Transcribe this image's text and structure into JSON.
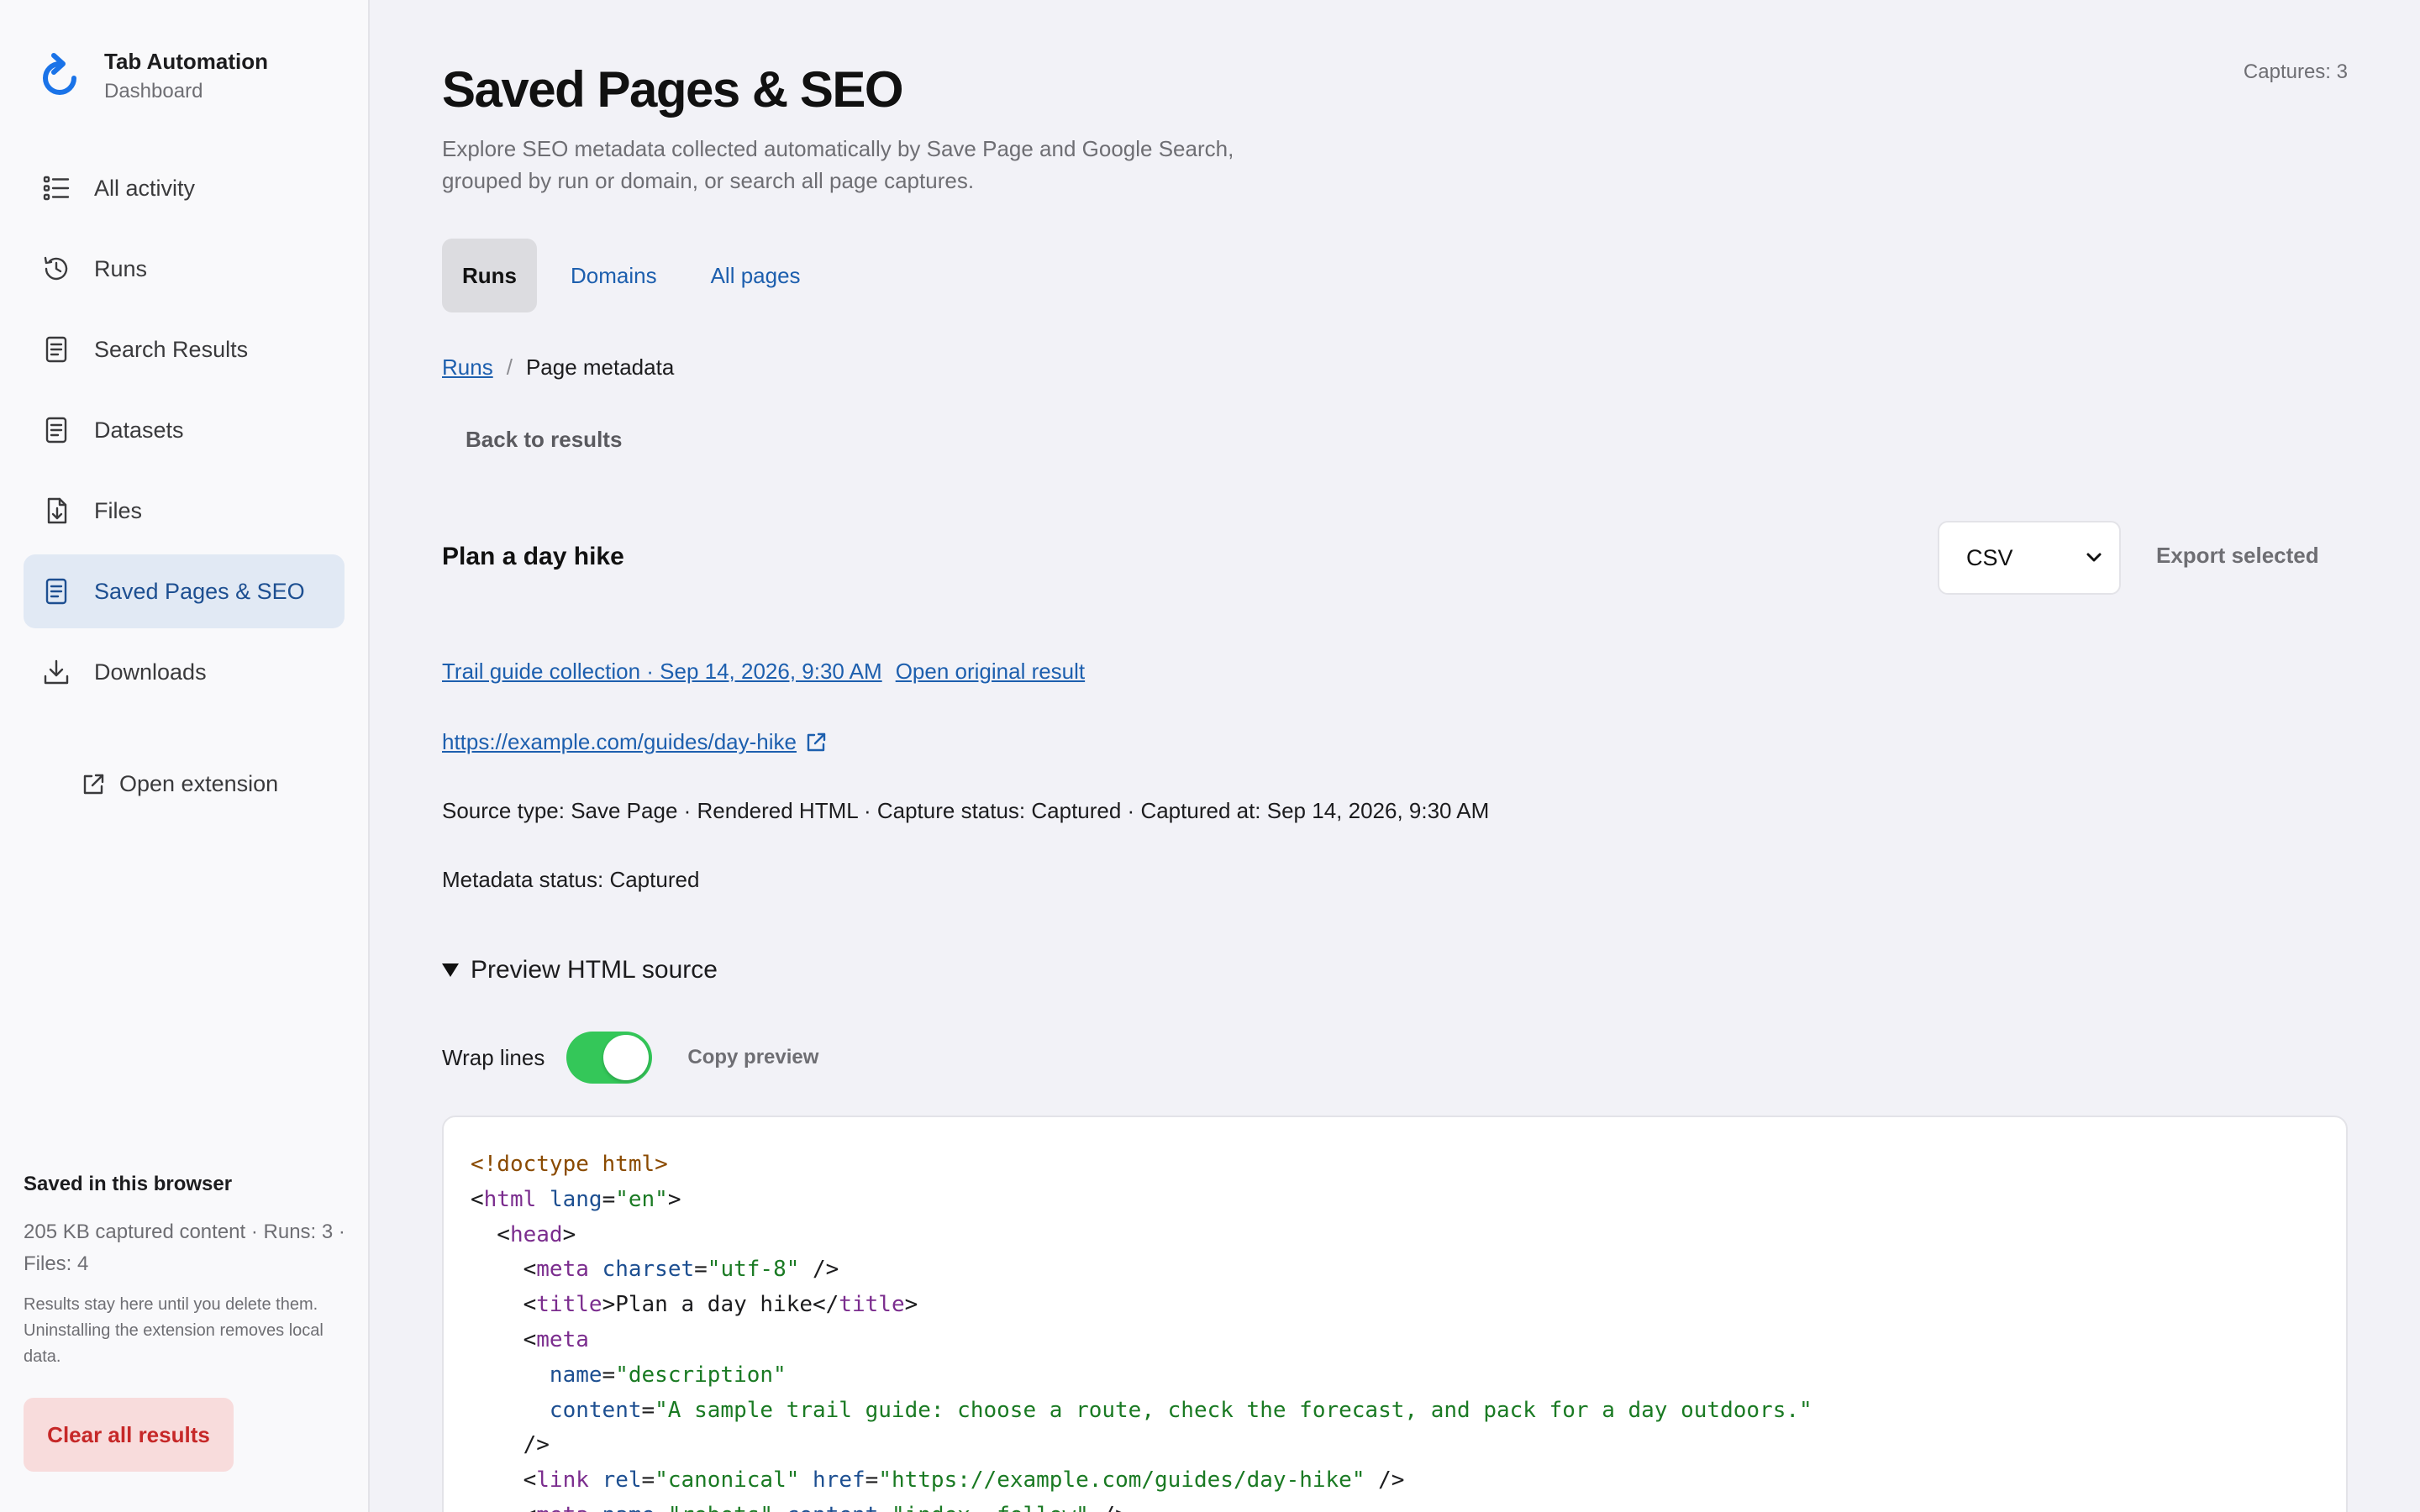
{
  "brand": {
    "title": "Tab Automation",
    "subtitle": "Dashboard"
  },
  "sidebar": {
    "items": [
      {
        "label": "All activity",
        "icon": "list-icon"
      },
      {
        "label": "Runs",
        "icon": "history-icon"
      },
      {
        "label": "Search Results",
        "icon": "document-icon"
      },
      {
        "label": "Datasets",
        "icon": "document-icon"
      },
      {
        "label": "Files",
        "icon": "file-download-icon"
      },
      {
        "label": "Saved Pages & SEO",
        "icon": "document-icon",
        "active": true
      },
      {
        "label": "Downloads",
        "icon": "download-icon"
      }
    ],
    "open_extension": "Open extension",
    "storage": {
      "title": "Saved in this browser",
      "info": "205 KB captured content · Runs: 3 · Files: 4",
      "note": "Results stay here until you delete them. Uninstalling the extension removes local data."
    },
    "clear_button": "Clear all results"
  },
  "header": {
    "title": "Saved Pages & SEO",
    "description": "Explore SEO metadata collected automatically by Save Page and Google Search, grouped by run or domain, or search all page captures.",
    "captures": "Captures: 3"
  },
  "tabs": [
    {
      "label": "Runs",
      "active": true
    },
    {
      "label": "Domains"
    },
    {
      "label": "All pages"
    }
  ],
  "breadcrumb": {
    "link": "Runs",
    "separator": "/",
    "current": "Page metadata"
  },
  "back_button": "Back to results",
  "result": {
    "title": "Plan a day hike",
    "export_format": "CSV",
    "export_button": "Export selected",
    "run_link": "Trail guide collection · Sep 14, 2026, 9:30 AM",
    "open_original": "Open original result",
    "url": "https://example.com/guides/day-hike",
    "source_line": "Source type: Save Page · Rendered HTML · Capture status: Captured · Captured at: Sep 14, 2026, 9:30 AM",
    "metadata_status": "Metadata status: Captured"
  },
  "preview": {
    "summary": "Preview HTML source",
    "wrap_label": "Wrap lines",
    "wrap_on": true,
    "copy_button": "Copy preview"
  },
  "code": {
    "doctype": "<!doctype html>",
    "html_open": "html",
    "lang_attr": "lang",
    "lang_val": "\"en\"",
    "head_open": "head",
    "meta": "meta",
    "charset_attr": "charset",
    "charset_val": "\"utf-8\"",
    "title_tag": "title",
    "title_text": "Plan a day hike",
    "name_attr": "name",
    "name_val": "\"description\"",
    "content_attr": "content",
    "content_val": "\"A sample trail guide: choose a route, check the forecast, and pack for a day outdoors.\"",
    "link_tag": "link",
    "rel_attr": "rel",
    "rel_val": "\"canonical\"",
    "href_attr": "href",
    "href_val": "\"https://example.com/guides/day-hike\"",
    "robots_name_val": "\"robots\"",
    "robots_content_val": "\"index, follow\""
  }
}
